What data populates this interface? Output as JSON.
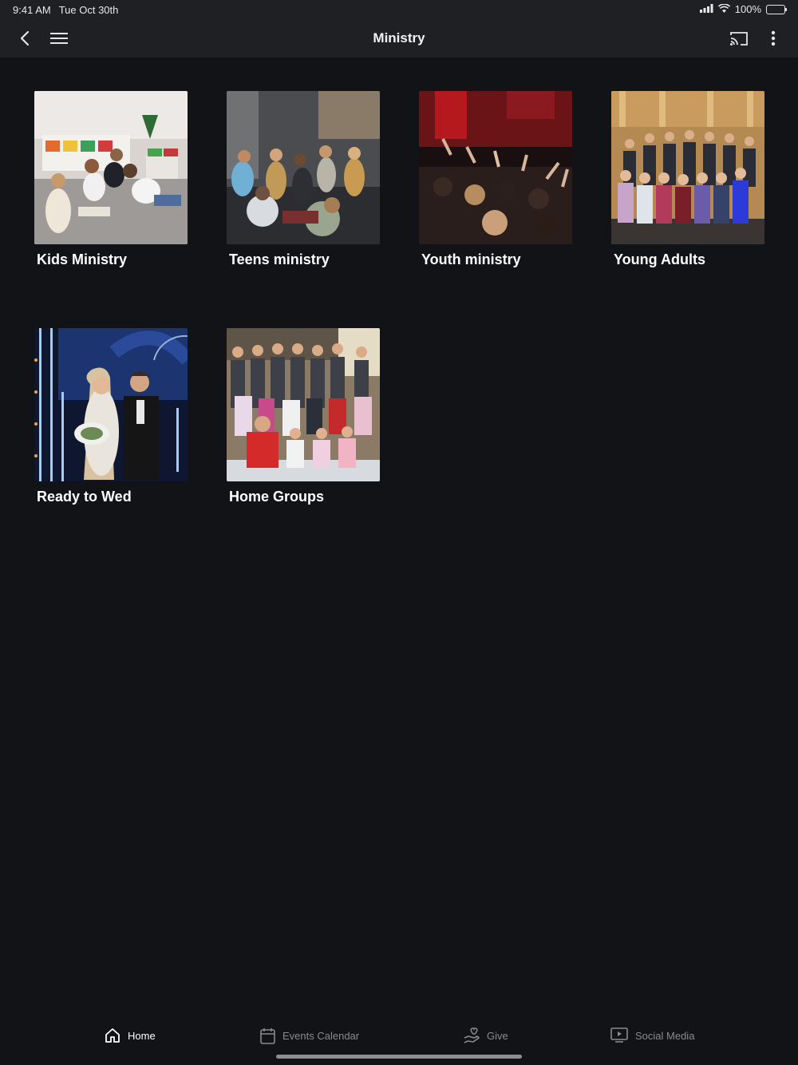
{
  "status": {
    "time": "9:41 AM",
    "date": "Tue Oct 30th",
    "battery_text": "100%",
    "battery_level": 1.0
  },
  "navbar": {
    "title": "Ministry",
    "back_icon": "chevron-left-icon",
    "menu_icon": "hamburger-icon",
    "cast_icon": "cast-icon",
    "more_icon": "more-vertical-icon"
  },
  "tiles": [
    {
      "label": "Kids Ministry",
      "image": "kids-ministry-photo"
    },
    {
      "label": "Teens ministry",
      "image": "teens-ministry-photo"
    },
    {
      "label": "Youth ministry",
      "image": "youth-ministry-photo"
    },
    {
      "label": "Young Adults",
      "image": "young-adults-photo"
    },
    {
      "label": "Ready to Wed",
      "image": "ready-to-wed-photo"
    },
    {
      "label": "Home Groups",
      "image": "home-groups-photo"
    }
  ],
  "tabbar": {
    "items": [
      {
        "label": "Home",
        "icon": "home-icon",
        "active": true
      },
      {
        "label": "Events Calendar",
        "icon": "calendar-icon",
        "active": false
      },
      {
        "label": "Give",
        "icon": "give-hand-heart-icon",
        "active": false
      },
      {
        "label": "Social Media",
        "icon": "play-screen-icon",
        "active": false
      }
    ]
  },
  "colors": {
    "background": "#121316",
    "bar": "#1f2023",
    "active_tab": "#ffffff",
    "inactive_tab": "#8a8b8e"
  }
}
